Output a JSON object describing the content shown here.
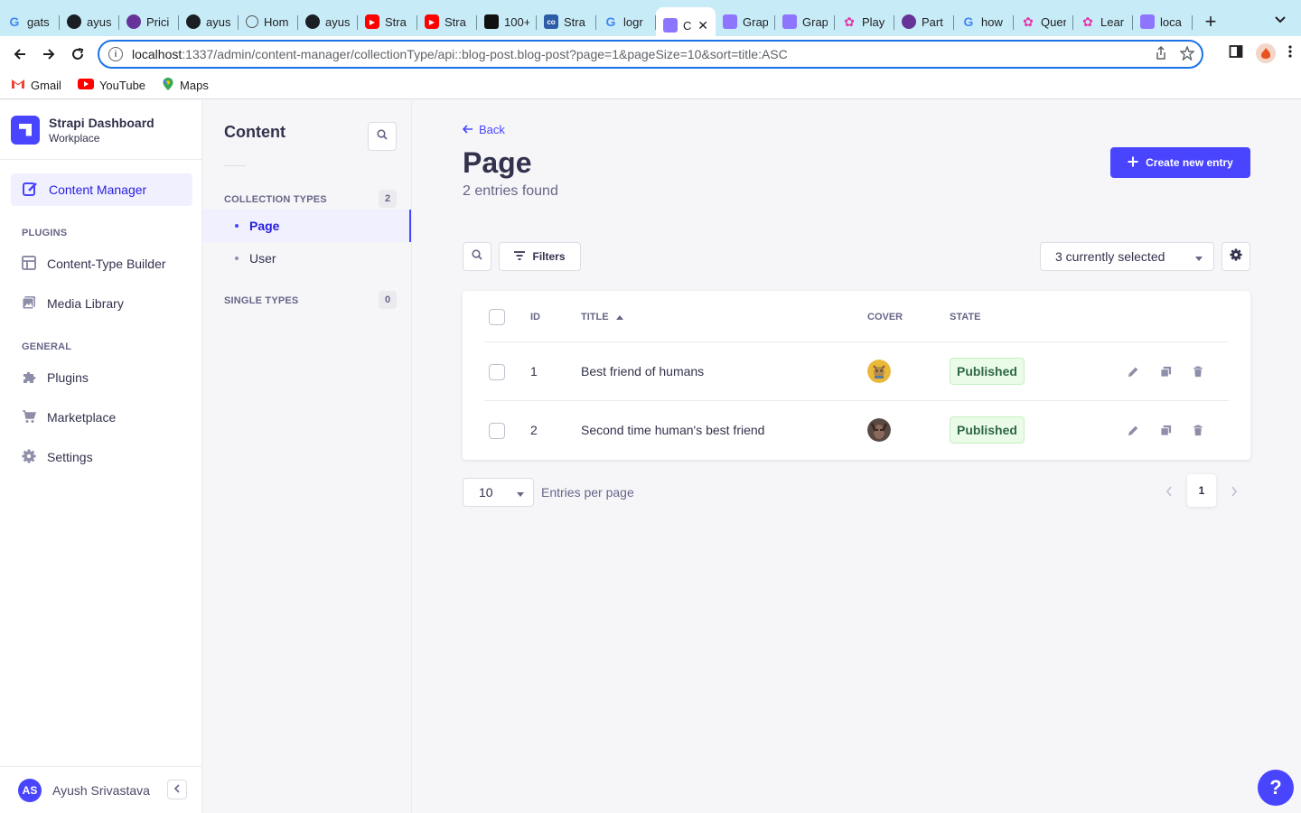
{
  "browser": {
    "tabs": [
      {
        "label": "gats",
        "icon": "google-icon"
      },
      {
        "label": "ayus",
        "icon": "github-icon"
      },
      {
        "label": "Prici",
        "icon": "gatsby-icon"
      },
      {
        "label": "ayus",
        "icon": "github-icon"
      },
      {
        "label": "Hom",
        "icon": "globe-icon"
      },
      {
        "label": "ayus",
        "icon": "github-icon"
      },
      {
        "label": "Stra",
        "icon": "youtube-icon"
      },
      {
        "label": "Stra",
        "icon": "youtube-icon"
      },
      {
        "label": "100+",
        "icon": "page-icon"
      },
      {
        "label": "Stra",
        "icon": "codesandbox-icon"
      },
      {
        "label": "logr",
        "icon": "google-icon"
      },
      {
        "label": "C",
        "icon": "strapi-icon",
        "active": true
      },
      {
        "label": "Grap",
        "icon": "strapi-icon"
      },
      {
        "label": "Grap",
        "icon": "strapi-icon"
      },
      {
        "label": "Play",
        "icon": "graphql-icon"
      },
      {
        "label": "Part",
        "icon": "gatsby-icon"
      },
      {
        "label": "how",
        "icon": "google-icon"
      },
      {
        "label": "Quer",
        "icon": "graphql-icon"
      },
      {
        "label": "Lear",
        "icon": "graphql-icon"
      },
      {
        "label": "loca",
        "icon": "strapi-icon"
      }
    ],
    "url_host": "localhost",
    "url_path": ":1337/admin/content-manager/collectionType/api::blog-post.blog-post?page=1&pageSize=10&sort=title:ASC",
    "bookmarks": [
      {
        "label": "Gmail",
        "icon": "gmail-icon"
      },
      {
        "label": "YouTube",
        "icon": "youtube-icon"
      },
      {
        "label": "Maps",
        "icon": "maps-icon"
      }
    ]
  },
  "mainnav": {
    "title": "Strapi Dashboard",
    "subtitle": "Workplace",
    "active_item": "Content Manager",
    "plugins_label": "PLUGINS",
    "plugins": [
      "Content-Type Builder",
      "Media Library"
    ],
    "general_label": "GENERAL",
    "general": [
      "Plugins",
      "Marketplace",
      "Settings"
    ],
    "user_initials": "AS",
    "user_name": "Ayush Srivastava"
  },
  "subnav": {
    "title": "Content",
    "collection_label": "COLLECTION TYPES",
    "collection_count": "2",
    "collection_items": [
      "Page",
      "User"
    ],
    "single_label": "SINGLE TYPES",
    "single_count": "0"
  },
  "main": {
    "back_label": "Back",
    "title": "Page",
    "subtitle": "2 entries found",
    "create_label": "Create new entry",
    "filters_label": "Filters",
    "columns_select": "3 currently selected",
    "headers": {
      "id": "ID",
      "title": "TITLE",
      "cover": "COVER",
      "state": "STATE"
    },
    "rows": [
      {
        "id": "1",
        "title": "Best friend of humans",
        "state": "Published"
      },
      {
        "id": "2",
        "title": "Second time human's best friend",
        "state": "Published"
      }
    ],
    "page_size": "10",
    "page_size_label": "Entries per page",
    "current_page": "1"
  },
  "colors": {
    "primary": "#4945ff",
    "published_bg": "#eafbe7",
    "published_text": "#2f6846"
  }
}
